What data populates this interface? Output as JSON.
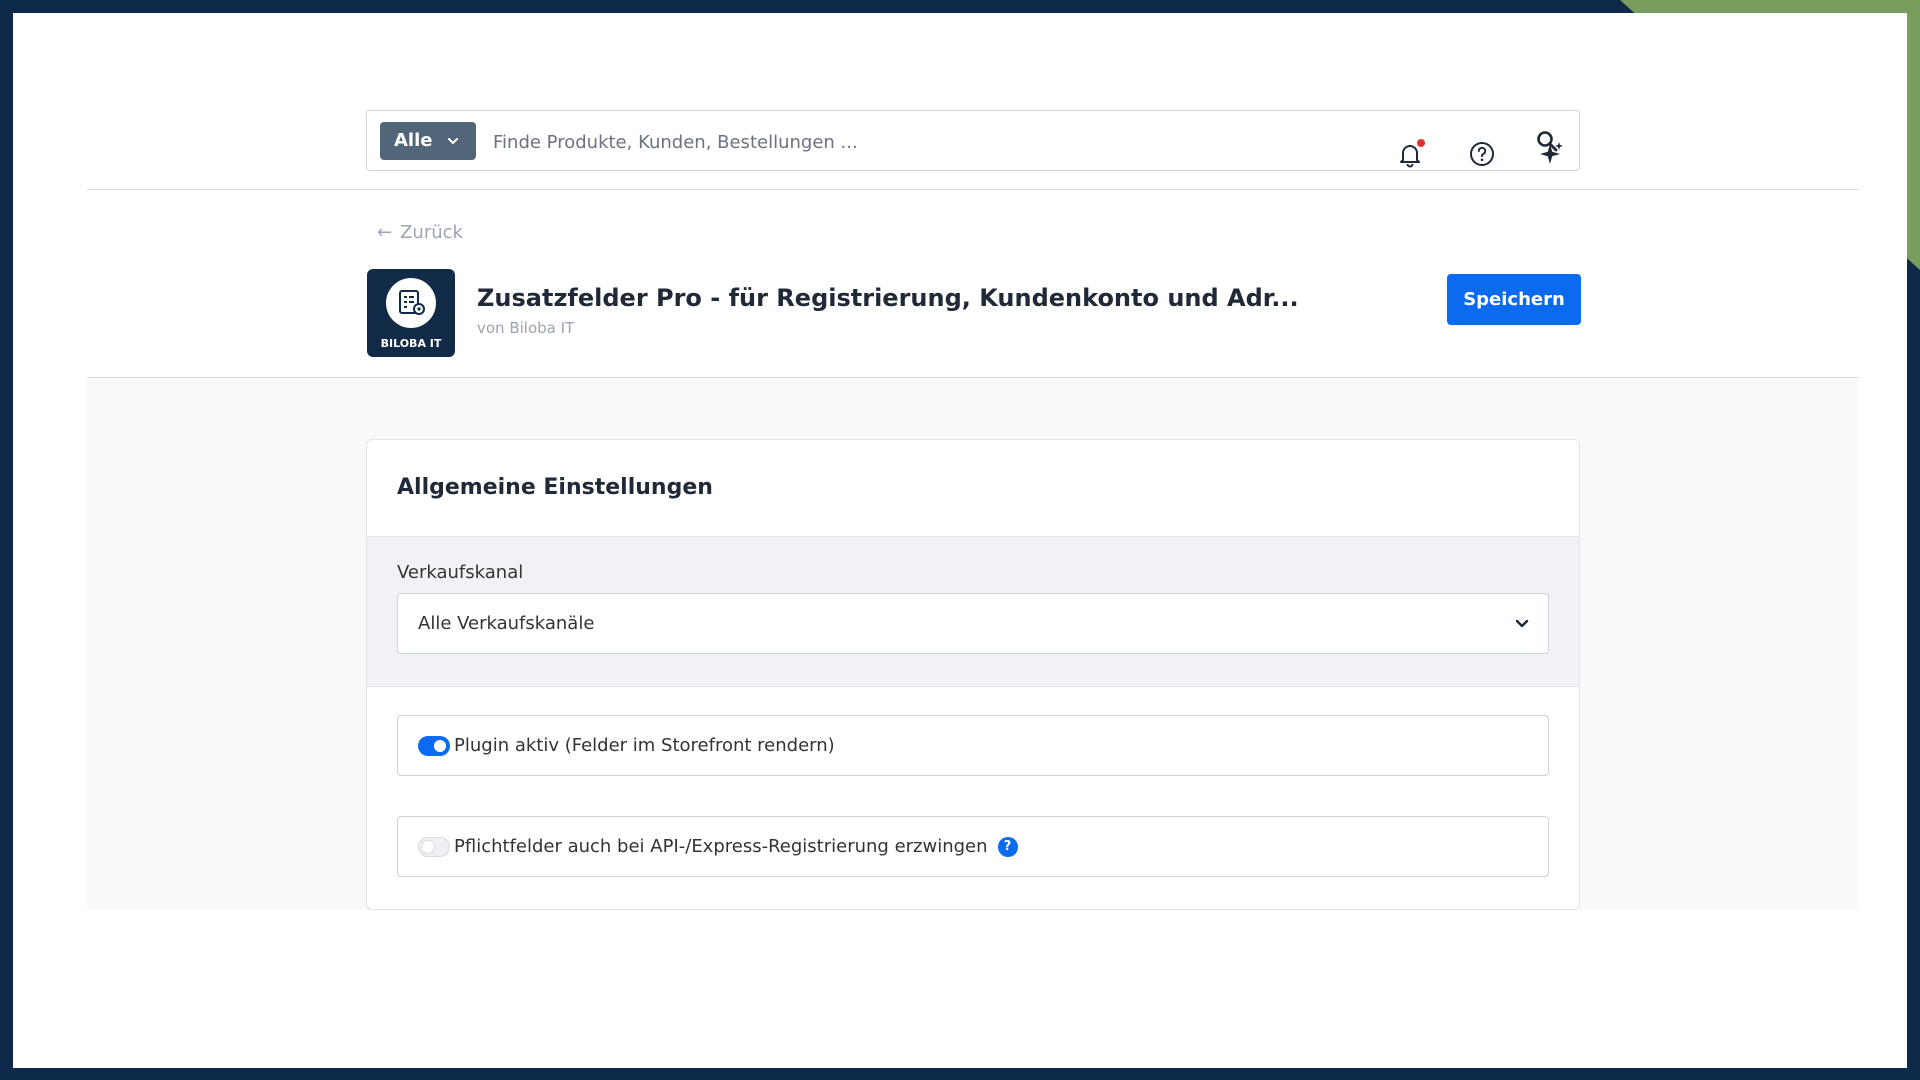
{
  "search": {
    "scope_label": "Alle",
    "placeholder": "Finde Produkte, Kunden, Bestellungen ..."
  },
  "header_icons": {
    "notifications": "bell-icon",
    "help": "help-circle-icon",
    "ai": "sparkle-icon",
    "notification_dot_color": "#e5322d"
  },
  "plugin": {
    "back_label": "Zurück",
    "title": "Zusatzfelder Pro - für Registrierung, Kundenkonto und Adr...",
    "vendor": "von Biloba IT",
    "logo_brand": "BILOBA IT",
    "save_label": "Speichern"
  },
  "settings": {
    "card_title": "Allgemeine Einstellungen",
    "sales_channel_label": "Verkaufskanal",
    "sales_channel_value": "Alle Verkaufskanäle",
    "toggles": [
      {
        "label": "Plugin aktiv (Felder im Storefront rendern)",
        "enabled": true
      },
      {
        "label": "Pflichtfelder auch bei API-/Express-Registrierung erzwingen",
        "enabled": false,
        "help_label": "?"
      }
    ]
  },
  "colors": {
    "primary": "#0b6bf0",
    "frame": "#0e2a4a",
    "frame_accent": "#789e5e"
  }
}
